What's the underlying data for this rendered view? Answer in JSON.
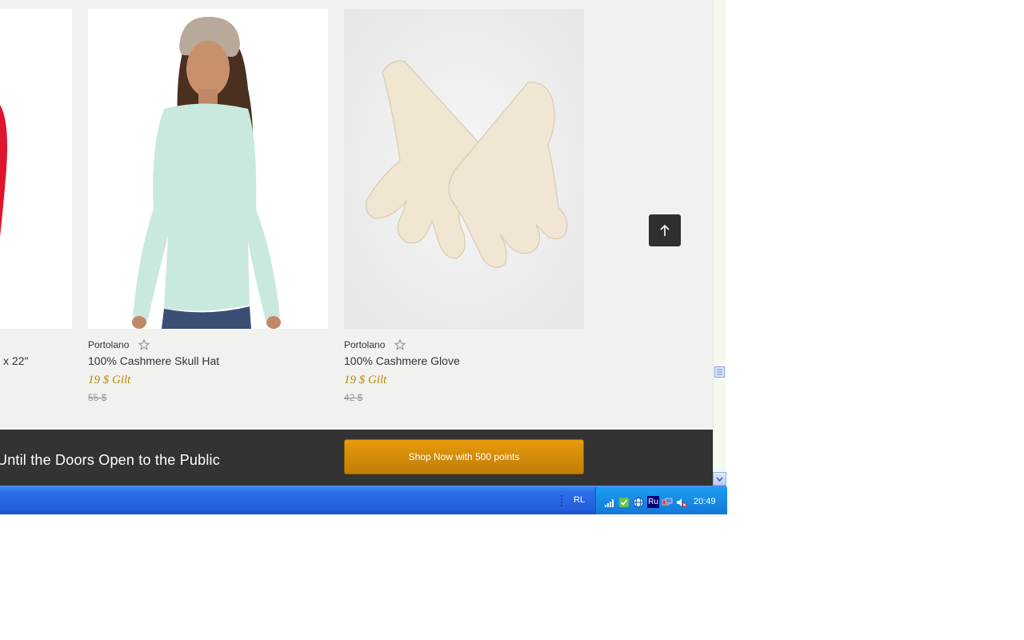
{
  "products": [
    {
      "brand": "",
      "name": "x 22\"",
      "price": "",
      "original_price": ""
    },
    {
      "brand": "Portolano",
      "name": "100% Cashmere Skull Hat",
      "price": "19 $ Gilt",
      "original_price": "55 $"
    },
    {
      "brand": "Portolano",
      "name": "100% Cashmere Glove",
      "price": "19 $ Gilt",
      "original_price": "42 $"
    }
  ],
  "banner": {
    "text": "Until the Doors Open to the Public",
    "shop_button": "Shop Now with 500 points"
  },
  "taskbar": {
    "language": "RL",
    "tray_language": "Ru",
    "clock": "20:49"
  },
  "icons": {
    "favorite": "star-outline-icon",
    "back_to_top": "arrow-up-icon",
    "scroll_down": "chevron-down-icon"
  },
  "colors": {
    "sale_price": "#b8860b",
    "shop_button": "#d88f08",
    "banner_bg": "#333333",
    "taskbar": "#245fdc"
  }
}
